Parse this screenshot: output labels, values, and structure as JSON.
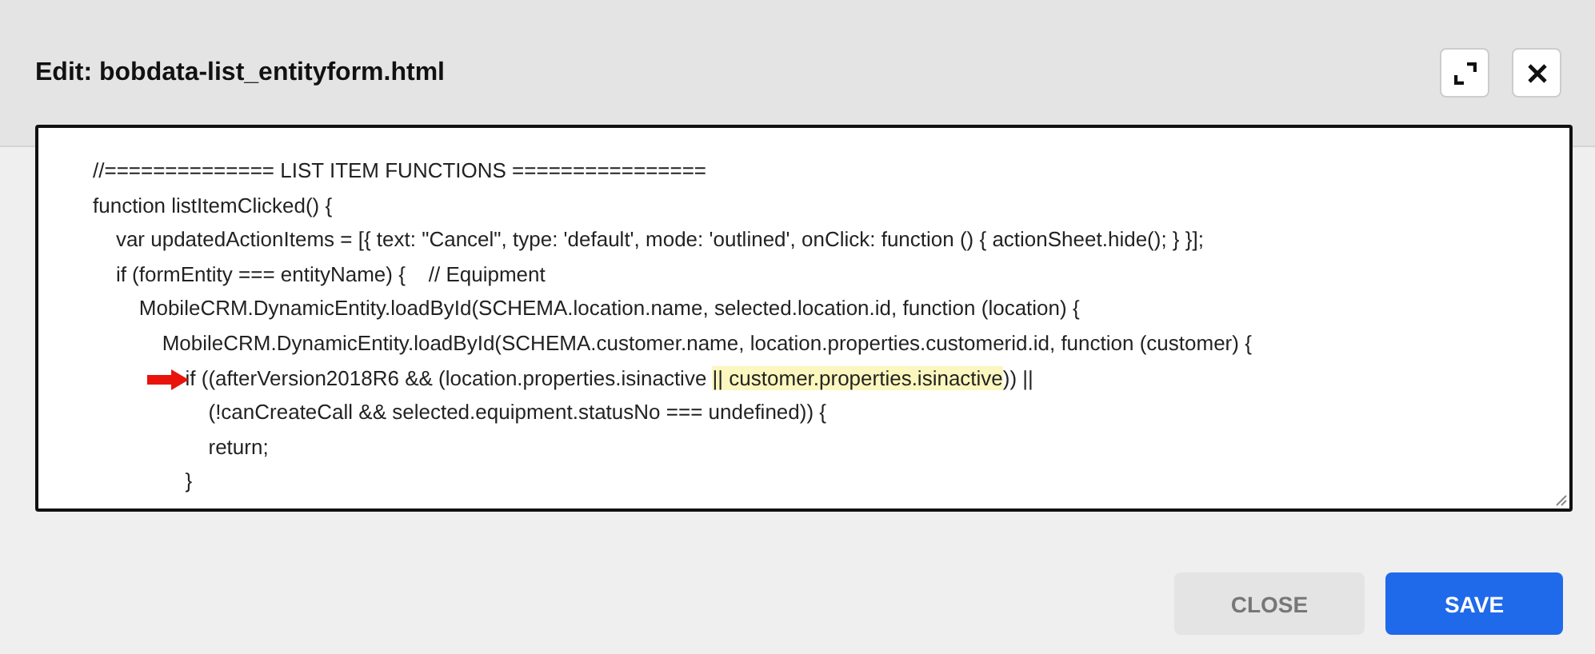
{
  "dialog": {
    "title": "Edit: bobdata-list_entityform.html"
  },
  "editor": {
    "lines": [
      {
        "marked": false,
        "segments": [
          {
            "text": "//============== LIST ITEM FUNCTIONS ================",
            "highlighted": false
          }
        ]
      },
      {
        "marked": false,
        "segments": [
          {
            "text": "function listItemClicked() {",
            "highlighted": false
          }
        ]
      },
      {
        "marked": false,
        "segments": [
          {
            "text": "    var updatedActionItems = [{ text: \"Cancel\", type: 'default', mode: 'outlined', onClick: function () { actionSheet.hide(); } }];",
            "highlighted": false
          }
        ]
      },
      {
        "marked": false,
        "segments": [
          {
            "text": "    if (formEntity === entityName) {    // Equipment",
            "highlighted": false
          }
        ]
      },
      {
        "marked": false,
        "segments": [
          {
            "text": "        MobileCRM.DynamicEntity.loadById(SCHEMA.location.name, selected.location.id, function (location) {",
            "highlighted": false
          }
        ]
      },
      {
        "marked": false,
        "segments": [
          {
            "text": "            MobileCRM.DynamicEntity.loadById(SCHEMA.customer.name, location.properties.customerid.id, function (customer) {",
            "highlighted": false
          }
        ]
      },
      {
        "marked": true,
        "segments": [
          {
            "text": "                if ((afterVersion2018R6 && (location.properties.isinactive ",
            "highlighted": false
          },
          {
            "text": "|| customer.properties.isinactive",
            "highlighted": true
          },
          {
            "text": ")) ||",
            "highlighted": false
          }
        ]
      },
      {
        "marked": false,
        "segments": [
          {
            "text": "                    (!canCreateCall && selected.equipment.statusNo === undefined)) {",
            "highlighted": false
          }
        ]
      },
      {
        "marked": false,
        "segments": [
          {
            "text": "                    return;",
            "highlighted": false
          }
        ]
      },
      {
        "marked": false,
        "segments": [
          {
            "text": "                }",
            "highlighted": false
          }
        ]
      }
    ]
  },
  "buttons": [
    {
      "label": "CLOSE",
      "kind": "secondary"
    },
    {
      "label": "SAVE",
      "kind": "primary"
    }
  ]
}
